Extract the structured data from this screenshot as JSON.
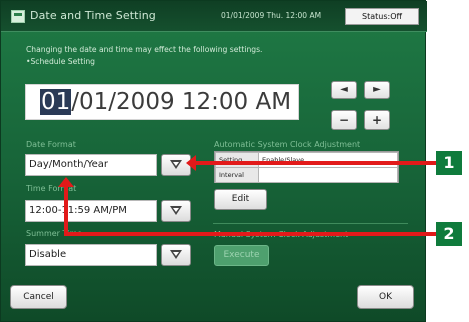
{
  "window": {
    "title": "Date and Time Setting",
    "datetime": "01/01/2009 Thu. 12:00 AM",
    "status": "Status:Off"
  },
  "notice": {
    "line1": "Changing the date and time may effect the following settings.",
    "line2": "•Schedule Setting"
  },
  "display": {
    "selected": "01",
    "rest": "/01/2009 12:00 AM"
  },
  "cursor_buttons": {
    "left": "◄",
    "right": "►",
    "minus": "−",
    "plus": "+"
  },
  "date_format": {
    "label": "Date Format",
    "value": "Day/Month/Year"
  },
  "time_format": {
    "label": "Time Format",
    "value": "12:00-11:59 AM/PM"
  },
  "summer_time": {
    "label": "Summer Time",
    "value": "Disable"
  },
  "auto_clock": {
    "heading": "Automatic System Clock Adjustment",
    "rows": [
      {
        "key": "Setting",
        "value": "Enable/Slave"
      },
      {
        "key": "Interval",
        "value": ""
      }
    ],
    "edit_label": "Edit"
  },
  "manual_clock": {
    "heading": "Manual System Clock Adjustment",
    "execute_label": "Execute"
  },
  "footer": {
    "cancel_label": "Cancel",
    "ok_label": "OK"
  },
  "callouts": [
    "1",
    "2"
  ],
  "colors": {
    "panel_green": "#176338",
    "callout_green": "#0f7b3c",
    "callout_line_red": "#e21a1a"
  }
}
